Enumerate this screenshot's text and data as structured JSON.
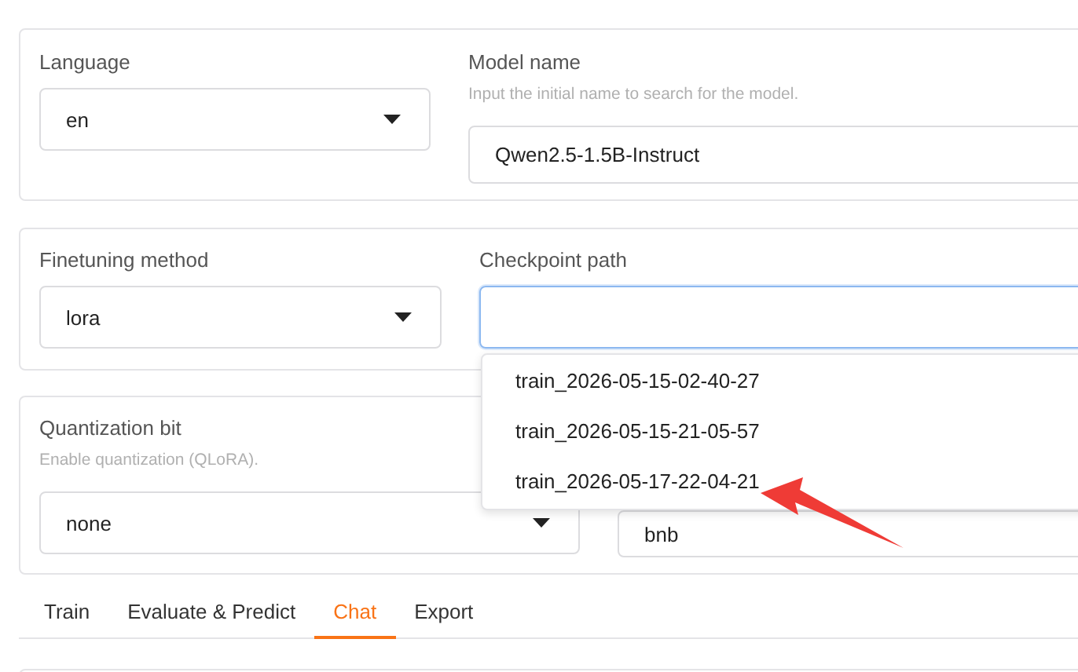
{
  "top_panel": {
    "language": {
      "label": "Language",
      "value": "en"
    },
    "model_name": {
      "label": "Model name",
      "hint": "Input the initial name to search for the model.",
      "value": "Qwen2.5-1.5B-Instruct"
    }
  },
  "method_panel": {
    "finetuning_method": {
      "label": "Finetuning method",
      "value": "lora"
    },
    "checkpoint_path": {
      "label": "Checkpoint path",
      "focused": true,
      "options": [
        "train_2026-05-15-02-40-27",
        "train_2026-05-15-21-05-57",
        "train_2026-05-17-22-04-21"
      ]
    }
  },
  "quant_panel": {
    "quantization_bit": {
      "label": "Quantization bit",
      "hint": "Enable quantization (QLoRA).",
      "value": "none"
    },
    "column_2": {
      "value": "bnb"
    }
  },
  "tabs": [
    {
      "label": "Train",
      "selected": false
    },
    {
      "label": "Evaluate & Predict",
      "selected": false
    },
    {
      "label": "Chat",
      "selected": true
    },
    {
      "label": "Export",
      "selected": false
    }
  ]
}
